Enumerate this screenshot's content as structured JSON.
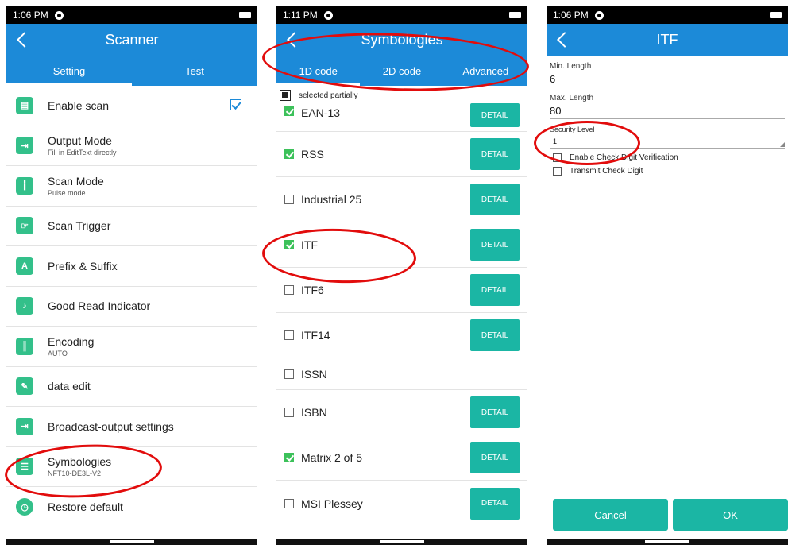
{
  "phone1": {
    "time": "1:06 PM",
    "title": "Scanner",
    "tabs": [
      "Setting",
      "Test"
    ],
    "items": [
      {
        "icon": "scan-icon",
        "title": "Enable scan",
        "sub": "",
        "checked": true
      },
      {
        "icon": "output-icon",
        "title": "Output Mode",
        "sub": "Fill in EditText directly"
      },
      {
        "icon": "barcode-icon",
        "title": "Scan Mode",
        "sub": "Pulse mode"
      },
      {
        "icon": "trigger-icon",
        "title": "Scan Trigger",
        "sub": ""
      },
      {
        "icon": "prefix-icon",
        "title": "Prefix & Suffix",
        "sub": ""
      },
      {
        "icon": "indicator-icon",
        "title": "Good Read Indicator",
        "sub": ""
      },
      {
        "icon": "encoding-icon",
        "title": "Encoding",
        "sub": "AUTO"
      },
      {
        "icon": "edit-icon",
        "title": "data edit",
        "sub": ""
      },
      {
        "icon": "broadcast-icon",
        "title": "Broadcast-output settings",
        "sub": ""
      },
      {
        "icon": "symbologies-icon",
        "title": "Symbologies",
        "sub": "NFT10-DE3L-V2"
      },
      {
        "icon": "restore-icon",
        "title": "Restore default",
        "sub": ""
      }
    ]
  },
  "phone2": {
    "time": "1:11 PM",
    "title": "Symbologies",
    "tabs": [
      "1D code",
      "2D code",
      "Advanced"
    ],
    "partial_label": "selected partially",
    "detail_label": "DETAIL",
    "symbologies": [
      {
        "name": "EAN-13",
        "checked": true,
        "detail": true
      },
      {
        "name": "RSS",
        "checked": true,
        "detail": true
      },
      {
        "name": "Industrial 25",
        "checked": false,
        "detail": true
      },
      {
        "name": "ITF",
        "checked": true,
        "detail": true
      },
      {
        "name": "ITF6",
        "checked": false,
        "detail": true
      },
      {
        "name": "ITF14",
        "checked": false,
        "detail": true
      },
      {
        "name": "ISSN",
        "checked": false,
        "detail": false
      },
      {
        "name": "ISBN",
        "checked": false,
        "detail": true
      },
      {
        "name": "Matrix 2 of 5",
        "checked": true,
        "detail": true
      },
      {
        "name": "MSI Plessey",
        "checked": false,
        "detail": true
      }
    ]
  },
  "phone3": {
    "time": "1:06 PM",
    "title": "ITF",
    "min_length_label": "Min. Length",
    "min_length_value": "6",
    "max_length_label": "Max. Length",
    "max_length_value": "80",
    "security_label": "Security Level",
    "security_value": "1",
    "options": [
      "Enable Check Digit Verification",
      "Transmit Check Digit"
    ],
    "cancel_label": "Cancel",
    "ok_label": "OK"
  },
  "colors": {
    "appbar": "#1c8ad8",
    "accent_button": "#1bb6a4",
    "icon_green": "#33c08a",
    "checkbox_green": "#3cc15a",
    "highlight_circle": "#e20c0c"
  }
}
